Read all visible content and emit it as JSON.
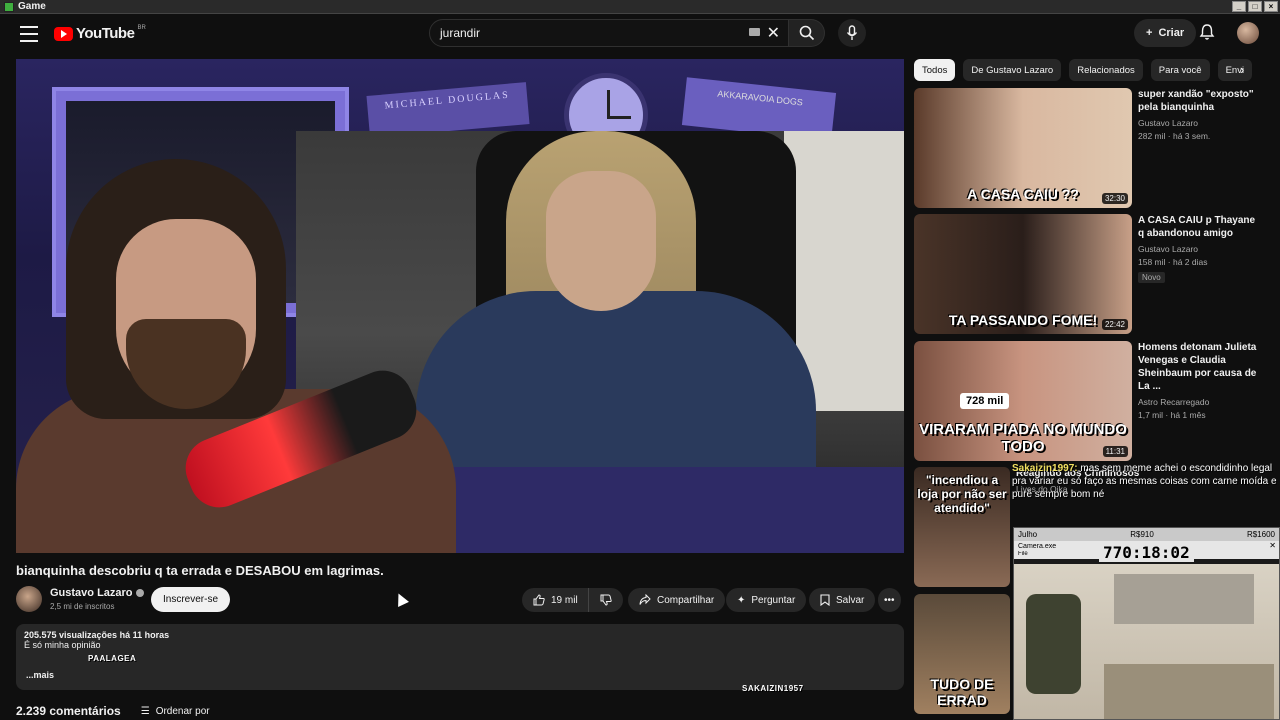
{
  "window": {
    "title": "Game",
    "controls": [
      "_",
      "□",
      "×"
    ]
  },
  "header": {
    "logo_text": "YouTube",
    "logo_region": "BR",
    "search_value": "jurandir",
    "create_label": "Criar"
  },
  "video": {
    "title": "bianquinha descobriu q ta errada e DESABOU em lagrimas.",
    "poster_left": "MICHAEL DOUGLAS",
    "poster_right": "AKKARAVOIA DOGS"
  },
  "channel": {
    "name": "Gustavo Lazaro",
    "subscribers": "2,5 mi de inscritos",
    "subscribe_label": "Inscrever-se"
  },
  "actions": {
    "likes": "19 mil",
    "share": "Compartilhar",
    "ask": "Perguntar",
    "save": "Salvar"
  },
  "description": {
    "views": "205.575 visualizações",
    "time": "há 11 horas",
    "text": "É só minha opinião",
    "more": "...mais"
  },
  "comments": {
    "count": "2.239 comentários",
    "order": "Ordenar por"
  },
  "overlays": {
    "tag1": "PAALAGEA",
    "tag2": "SAKAIZIN1957"
  },
  "chips": [
    "Todos",
    "De Gustavo Lazaro",
    "Relacionados",
    "Para você",
    "Envi"
  ],
  "recommendations": [
    {
      "title": "super xandão \"exposto\" pela bianquinha",
      "channel": "Gustavo Lazaro",
      "views": "282 mil",
      "age": "há 3 sem.",
      "duration": "32:30",
      "caption": "A CASA CAIU ??",
      "badge": ""
    },
    {
      "title": "A CASA CAIU p Thayane q abandonou amigo",
      "channel": "Gustavo Lazaro",
      "views": "158 mil",
      "age": "há 2 dias",
      "duration": "22:42",
      "caption": "TA PASSANDO FOME!",
      "badge": "Novo"
    },
    {
      "title": "Homens detonam Julieta Venegas e Claudia Sheinbaum por causa de La ...",
      "channel": "Astro Recarregado",
      "views": "1,7 mil",
      "age": "há 1 mês",
      "duration": "11:31",
      "caption": "VIRARAM PIADA NO MUNDO TODO",
      "badge": "728 mil"
    },
    {
      "title": "Reagindo aos Criminosos",
      "channel": "Lives do Oika",
      "views": "",
      "age": "",
      "duration": "",
      "caption": "\"incendiou a loja por não ser atendido\"",
      "badge": ""
    },
    {
      "title": "",
      "channel": "",
      "views": "",
      "age": "",
      "duration": "",
      "caption": "TUDO DE ERRAD",
      "badge": ""
    }
  ],
  "chat": {
    "user": "Sakaizin1997:",
    "message": "mas sem meme achei o escondidinho legal pra variar eu só faço as mesmas coisas com carne moída e purê sempre bom né"
  },
  "obs": {
    "user": "Julho",
    "amount1": "R$910",
    "amount2": "R$1600",
    "window": "Camera.exe",
    "menu": "File",
    "timer": "770:18:02"
  },
  "colors": {
    "background": "#0f0f0f",
    "brand_red": "#ff0000",
    "pill_bg": "#272727"
  }
}
